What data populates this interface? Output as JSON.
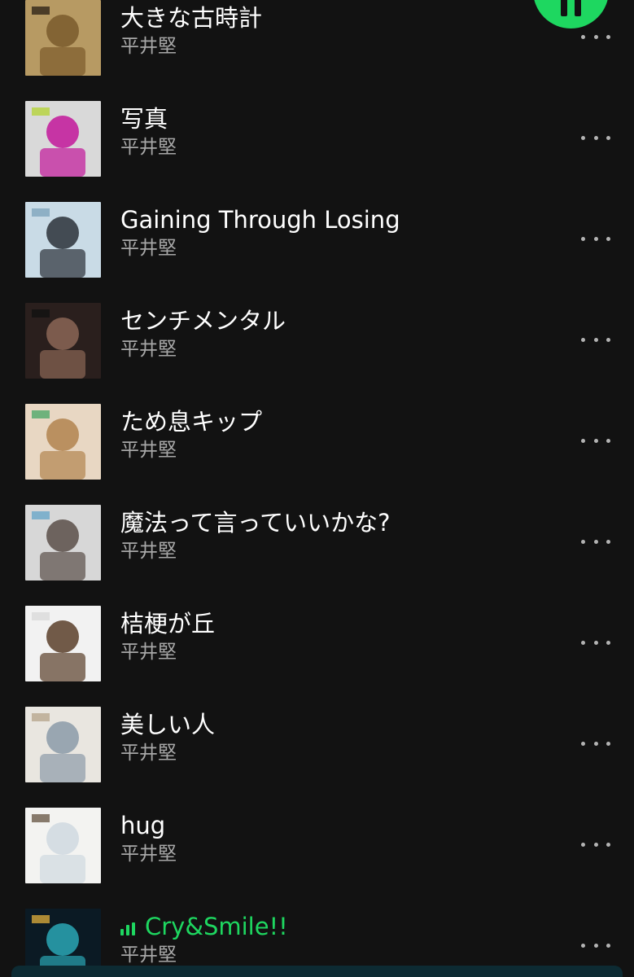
{
  "tracks": [
    {
      "title": "大きな古時計",
      "artist": "平井堅",
      "playing": false,
      "cover_colors": [
        "#b79a63",
        "#7a5a2b",
        "#2f2418"
      ]
    },
    {
      "title": "写真",
      "artist": "平井堅",
      "playing": false,
      "cover_colors": [
        "#d9d9d9",
        "#c2169a",
        "#b5d33a"
      ]
    },
    {
      "title": "Gaining Through Losing",
      "artist": "平井堅",
      "playing": false,
      "cover_colors": [
        "#c9dbe6",
        "#2b3138",
        "#7fa5bd"
      ]
    },
    {
      "title": "センチメンタル",
      "artist": "平井堅",
      "playing": false,
      "cover_colors": [
        "#2a1f1d",
        "#8b6656",
        "#121212"
      ]
    },
    {
      "title": "ため息キップ",
      "artist": "平井堅",
      "playing": false,
      "cover_colors": [
        "#e8d7c3",
        "#b2844f",
        "#4fa96a"
      ]
    },
    {
      "title": "魔法って言っていいかな?",
      "artist": "平井堅",
      "playing": false,
      "cover_colors": [
        "#d7d7d7",
        "#5a4f49",
        "#6aa7c9"
      ]
    },
    {
      "title": "桔梗が丘",
      "artist": "平井堅",
      "playing": false,
      "cover_colors": [
        "#f2f2f2",
        "#5a3f2a",
        "#d9d9d9"
      ]
    },
    {
      "title": "美しい人",
      "artist": "平井堅",
      "playing": false,
      "cover_colors": [
        "#e9e6e0",
        "#8b9aa8",
        "#b8a78f"
      ]
    },
    {
      "title": "hug",
      "artist": "平井堅",
      "playing": false,
      "cover_colors": [
        "#f3f3f1",
        "#cfd8e0",
        "#6c5b4b"
      ]
    },
    {
      "title": "Cry&Smile!!",
      "artist": "平井堅",
      "playing": true,
      "cover_colors": [
        "#0b1a24",
        "#2aa7b5",
        "#d4a63a"
      ]
    }
  ],
  "accent_color": "#1ed760",
  "icons": {
    "more": "more-options-icon",
    "playing": "equalizer-icon",
    "pause": "pause-icon"
  }
}
